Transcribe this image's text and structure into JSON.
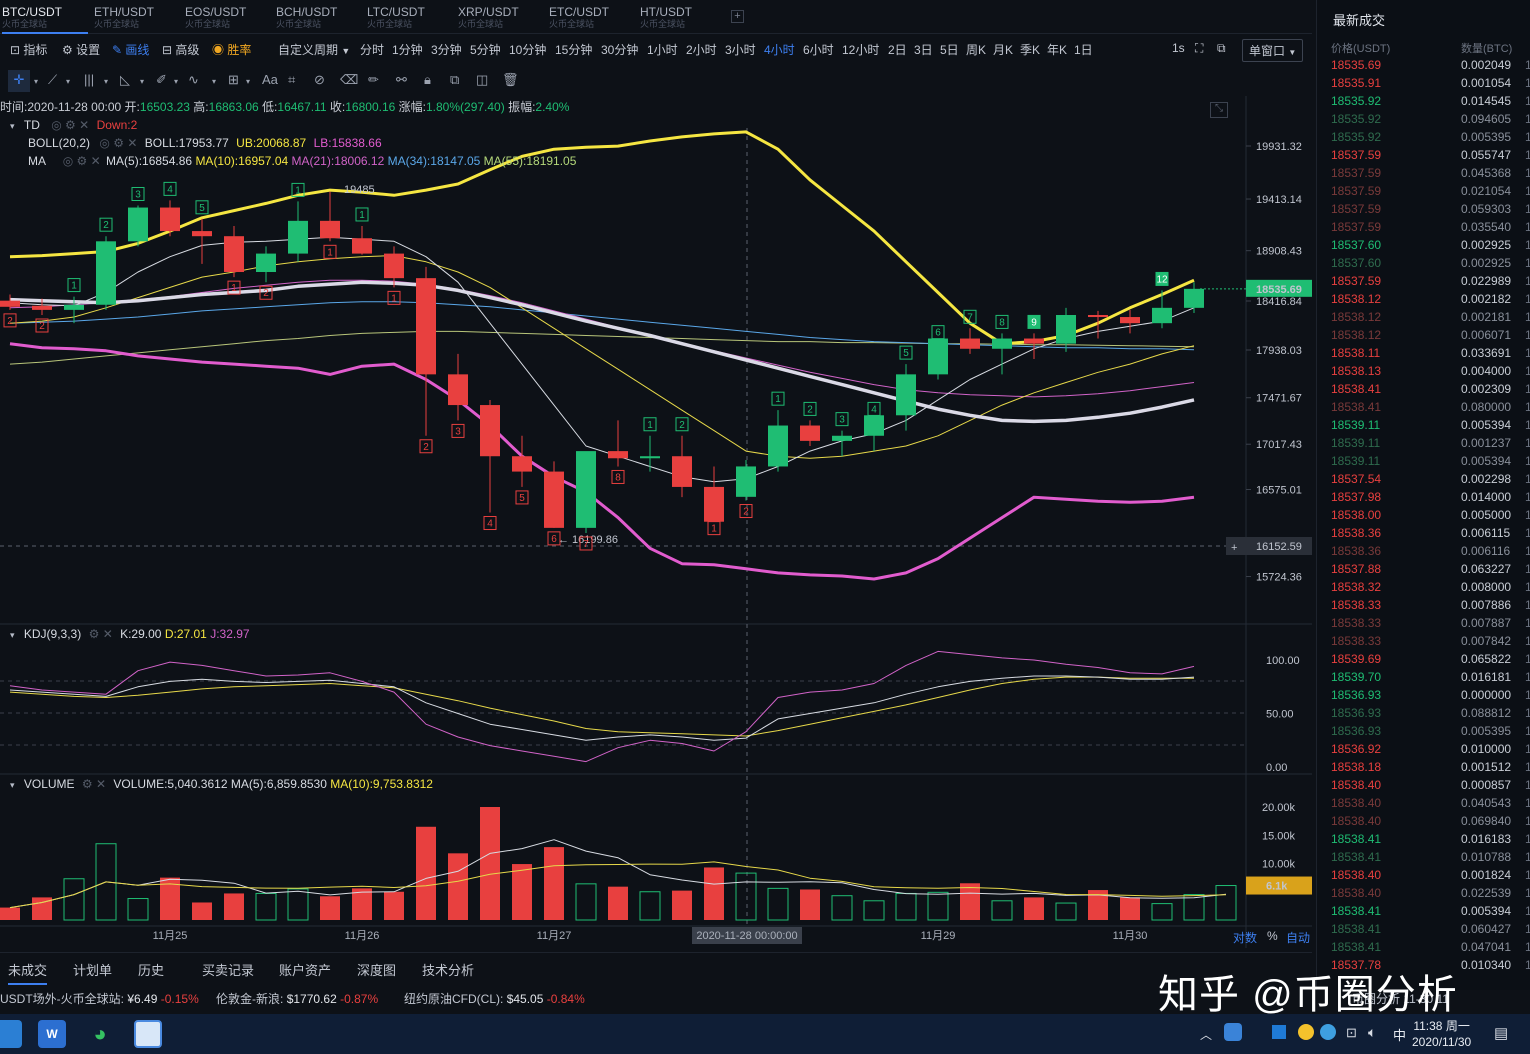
{
  "tabs": [
    {
      "label": "BTC/USDT",
      "sub": "火币全球站",
      "active": true
    },
    {
      "label": "ETH/USDT",
      "sub": "火币全球站"
    },
    {
      "label": "EOS/USDT",
      "sub": "火币全球站"
    },
    {
      "label": "BCH/USDT",
      "sub": "火币全球站"
    },
    {
      "label": "LTC/USDT",
      "sub": "火币全球站"
    },
    {
      "label": "XRP/USDT",
      "sub": "火币全球站"
    },
    {
      "label": "ETC/USDT",
      "sub": "火币全球站"
    },
    {
      "label": "HT/USDT",
      "sub": "火币全球站"
    }
  ],
  "tab_add": "+",
  "toolbar": {
    "indicators": "指标",
    "settings": "设置",
    "draw": "画线",
    "advanced": "高级",
    "winrate": "胜率",
    "custom_period": "自定义周期",
    "periods": [
      "分时",
      "1分钟",
      "3分钟",
      "5分钟",
      "10分钟",
      "15分钟",
      "30分钟",
      "1小时",
      "2小时",
      "3小时",
      "4小时",
      "6小时",
      "12小时",
      "2日",
      "3日",
      "5日",
      "周K",
      "月K",
      "季K",
      "年K",
      "1日"
    ],
    "active_period": "4小时",
    "interval_1s": "1s",
    "window_select": "单窗口"
  },
  "drawing_tools_text": "Aa",
  "info": {
    "time_label": "时间:",
    "time": "2020-11-28 00:00",
    "open_label": "开:",
    "open": "16503.23",
    "high_label": "高:",
    "high": "16863.06",
    "low_label": "低:",
    "low": "16467.11",
    "close_label": "收:",
    "close": "16800.16",
    "change_label": "涨幅:",
    "change": "1.80%(297.40)",
    "amp_label": "振幅:",
    "amp": "2.40%"
  },
  "td_legend": {
    "name": "TD",
    "status": "Down:2"
  },
  "boll_legend": {
    "name": "BOLL(20,2)",
    "boll": "BOLL:17953.77",
    "ub": "UB:20068.87",
    "lb": "LB:15838.66"
  },
  "ma_legend": {
    "name": "MA",
    "ma5": "MA(5):16854.86",
    "ma10": "MA(10):16957.04",
    "ma21": "MA(21):18006.12",
    "ma34": "MA(34):18147.05",
    "ma55": "MA(55):18191.05"
  },
  "kdj_legend": {
    "name": "KDJ(9,3,3)",
    "k": "K:29.00",
    "d": "D:27.01",
    "j": "J:32.97"
  },
  "vol_legend": {
    "name": "VOLUME",
    "vol": "VOLUME:5,040.3612",
    "ma5": "MA(5):6,859.8530",
    "ma10": "MA(10):9,753.8312"
  },
  "price_axis": [
    "19931.32",
    "19413.14",
    "18908.43",
    "18416.84",
    "17938.03",
    "17471.67",
    "17017.43",
    "16575.01",
    "15724.36"
  ],
  "last_price": "18535.69",
  "crosshair_price": "16152.59",
  "high_marker": "19485",
  "low_marker": "← 16199.86",
  "kdj_axis": [
    "100.00",
    "50.00",
    "0.00"
  ],
  "vol_axis": [
    "20.00k",
    "15.00k",
    "10.00k"
  ],
  "vol_current": "6.1k",
  "x_labels": [
    "11月25",
    "11月26",
    "11月27",
    "11月29",
    "11月30"
  ],
  "crosshair_time": "2020-11-28 00:00:00",
  "axis_modes": [
    "对数",
    "%",
    "自动"
  ],
  "colors": {
    "up": "#1fbd73",
    "down": "#e8403f",
    "boll_ub": "#f5e642",
    "boll_lb": "#e15cce",
    "ma_white": "#e6e6ea"
  },
  "chart_data": {
    "type": "candlestick",
    "interval": "4小时",
    "candles": [
      {
        "o": 18420,
        "h": 18480,
        "l": 18330,
        "c": 18360,
        "td": "2",
        "tdc": "down"
      },
      {
        "o": 18370,
        "h": 18440,
        "l": 18280,
        "c": 18330,
        "td": "2",
        "tdc": "down"
      },
      {
        "o": 18330,
        "h": 18460,
        "l": 18200,
        "c": 18380,
        "td": "1",
        "tdc": "up"
      },
      {
        "o": 18380,
        "h": 19050,
        "l": 18330,
        "c": 19000,
        "td": "2",
        "tdc": "up"
      },
      {
        "o": 19000,
        "h": 19350,
        "l": 18950,
        "c": 19330,
        "td": "3",
        "tdc": "up"
      },
      {
        "o": 19330,
        "h": 19400,
        "l": 19050,
        "c": 19100,
        "td": "4",
        "tdc": "up"
      },
      {
        "o": 19100,
        "h": 19220,
        "l": 18780,
        "c": 19050,
        "td": "5",
        "tdc": "up"
      },
      {
        "o": 19050,
        "h": 19150,
        "l": 18650,
        "c": 18700,
        "td": "1",
        "tdc": "down"
      },
      {
        "o": 18700,
        "h": 18950,
        "l": 18600,
        "c": 18880,
        "td": "2",
        "tdc": "down"
      },
      {
        "o": 18880,
        "h": 19390,
        "l": 18800,
        "c": 19200,
        "td": "1",
        "tdc": "up"
      },
      {
        "o": 19200,
        "h": 19485,
        "l": 19000,
        "c": 19030,
        "td": "1",
        "tdc": "down"
      },
      {
        "o": 19030,
        "h": 19150,
        "l": 18870,
        "c": 18880,
        "td": "1",
        "tdc": "up"
      },
      {
        "o": 18880,
        "h": 18950,
        "l": 18550,
        "c": 18640,
        "td": "1",
        "tdc": "down"
      },
      {
        "o": 18640,
        "h": 18750,
        "l": 17100,
        "c": 17700,
        "td": "2",
        "tdc": "down"
      },
      {
        "o": 17700,
        "h": 17900,
        "l": 17250,
        "c": 17400,
        "td": "3",
        "tdc": "down"
      },
      {
        "o": 17400,
        "h": 17450,
        "l": 16350,
        "c": 16900,
        "td": "4",
        "tdc": "down"
      },
      {
        "o": 16900,
        "h": 17100,
        "l": 16600,
        "c": 16750,
        "td": "5",
        "tdc": "down"
      },
      {
        "o": 16750,
        "h": 16850,
        "l": 16199.86,
        "c": 16200,
        "td": "6",
        "tdc": "down"
      },
      {
        "o": 16200,
        "h": 16900,
        "l": 16150,
        "c": 16950,
        "td": "7",
        "tdc": "down"
      },
      {
        "o": 16950,
        "h": 17250,
        "l": 16800,
        "c": 16880,
        "td": "8",
        "tdc": "down"
      },
      {
        "o": 16880,
        "h": 17100,
        "l": 16750,
        "c": 16900,
        "td": "1",
        "tdc": "up"
      },
      {
        "o": 16900,
        "h": 17100,
        "l": 16500,
        "c": 16600,
        "td": "2",
        "tdc": "up"
      },
      {
        "o": 16600,
        "h": 16800,
        "l": 16300,
        "c": 16260,
        "td": "1",
        "tdc": "down"
      },
      {
        "o": 16503.23,
        "h": 16863.06,
        "l": 16467.11,
        "c": 16800.16,
        "td": "2",
        "tdc": "down"
      },
      {
        "o": 16800,
        "h": 17350,
        "l": 16750,
        "c": 17200,
        "td": "1",
        "tdc": "up"
      },
      {
        "o": 17200,
        "h": 17250,
        "l": 17000,
        "c": 17050,
        "td": "2",
        "tdc": "up"
      },
      {
        "o": 17050,
        "h": 17150,
        "l": 16900,
        "c": 17100,
        "td": "3",
        "tdc": "up"
      },
      {
        "o": 17100,
        "h": 17250,
        "l": 16950,
        "c": 17300,
        "td": "4",
        "tdc": "up"
      },
      {
        "o": 17300,
        "h": 17800,
        "l": 17150,
        "c": 17700,
        "td": "5",
        "tdc": "up"
      },
      {
        "o": 17700,
        "h": 18000,
        "l": 17650,
        "c": 18050,
        "td": "6",
        "tdc": "up"
      },
      {
        "o": 18050,
        "h": 18150,
        "l": 17900,
        "c": 17950,
        "td": "7",
        "tdc": "up"
      },
      {
        "o": 17950,
        "h": 18100,
        "l": 17700,
        "c": 18050,
        "td": "8",
        "tdc": "up"
      },
      {
        "o": 18050,
        "h": 18100,
        "l": 17850,
        "c": 18000,
        "td": "9",
        "tdc": "up9"
      },
      {
        "o": 18000,
        "h": 18350,
        "l": 17920,
        "c": 18280,
        "td": "",
        "tdc": "up"
      },
      {
        "o": 18280,
        "h": 18320,
        "l": 18050,
        "c": 18260,
        "td": "",
        "tdc": "up"
      },
      {
        "o": 18260,
        "h": 18330,
        "l": 18100,
        "c": 18200,
        "td": "",
        "tdc": "down"
      },
      {
        "o": 18200,
        "h": 18520,
        "l": 18150,
        "c": 18350,
        "td": "12",
        "tdc": "up"
      },
      {
        "o": 18350,
        "h": 18600,
        "l": 18300,
        "c": 18535.69,
        "td": "",
        "tdc": "up"
      }
    ],
    "volume": [
      2200,
      4000,
      7300,
      13500,
      3800,
      7500,
      3100,
      4700,
      4700,
      5500,
      4200,
      5600,
      5000,
      16500,
      11800,
      20000,
      9900,
      12900,
      6400,
      5900,
      5000,
      5200,
      9300,
      8300,
      5600,
      5400,
      4300,
      3400,
      4700,
      4900,
      6500,
      3400,
      4000,
      3000,
      5300,
      4000,
      2900,
      4500,
      6100
    ],
    "boll": {
      "ub": [
        18850,
        18860,
        18880,
        18900,
        18980,
        19100,
        19230,
        19300,
        19370,
        19450,
        19500,
        19480,
        19450,
        19500,
        19560,
        19700,
        19830,
        19900,
        19920,
        19930,
        19980,
        20020,
        20050,
        20068.87,
        19900,
        19600,
        19350,
        19100,
        18800,
        18500,
        18200,
        18000,
        18020,
        18080,
        18200,
        18350,
        18480,
        18620
      ],
      "lb": [
        18000,
        17960,
        17950,
        17930,
        17880,
        17850,
        17820,
        17800,
        17780,
        17760,
        17700,
        17780,
        17800,
        17650,
        17450,
        17200,
        16900,
        16700,
        16550,
        16300,
        16000,
        15850,
        15838.66,
        15800,
        15760,
        15740,
        15730,
        15700,
        15760,
        15900,
        16100,
        16300,
        16500,
        16480,
        16460,
        16450,
        16460,
        16500
      ]
    },
    "kdj": {
      "k": [
        72,
        70,
        68,
        66,
        75,
        80,
        82,
        80,
        79,
        80,
        81,
        78,
        75,
        60,
        50,
        40,
        35,
        30,
        25,
        28,
        30,
        28,
        25,
        27,
        45,
        50,
        55,
        60,
        68,
        75,
        80,
        83,
        85,
        85,
        84,
        82,
        82,
        84
      ],
      "d": [
        70,
        68,
        66,
        65,
        67,
        70,
        73,
        75,
        76,
        77,
        78,
        76,
        74,
        68,
        62,
        55,
        49,
        43,
        36,
        33,
        32,
        31,
        30,
        29,
        34,
        40,
        46,
        52,
        58,
        65,
        72,
        78,
        82,
        84,
        84,
        83,
        83,
        83
      ],
      "j": [
        76,
        72,
        70,
        68,
        90,
        98,
        95,
        90,
        85,
        86,
        88,
        80,
        70,
        40,
        28,
        20,
        15,
        10,
        5,
        18,
        25,
        22,
        15,
        33,
        65,
        70,
        72,
        78,
        95,
        108,
        105,
        102,
        100,
        96,
        93,
        88,
        87,
        94
      ]
    },
    "ma_white": [
      18430,
      18420,
      18410,
      18400,
      18420,
      18450,
      18480,
      18500,
      18520,
      18560,
      18580,
      18600,
      18590,
      18570,
      18520,
      18450,
      18380,
      18300,
      18220,
      18150,
      18080,
      18000,
      17920,
      17840,
      17760,
      17680,
      17600,
      17520,
      17440,
      17360,
      17300,
      17250,
      17240,
      17250,
      17280,
      17320,
      17380,
      17450
    ],
    "ma5": [
      18400,
      18380,
      18370,
      18500,
      18700,
      18850,
      18960,
      18990,
      19000,
      19020,
      19040,
      19020,
      19000,
      18850,
      18600,
      18200,
      17800,
      17400,
      17000,
      16900,
      16800,
      16700,
      16650,
      16680,
      16800,
      16950,
      17050,
      17120,
      17250,
      17450,
      17650,
      17800,
      17950,
      18050,
      18120,
      18170,
      18220,
      18350
    ],
    "ma10": [
      18200,
      18220,
      18260,
      18350,
      18450,
      18550,
      18650,
      18700,
      18760,
      18800,
      18830,
      18850,
      18860,
      18800,
      18700,
      18550,
      18350,
      18150,
      17950,
      17750,
      17550,
      17350,
      17150,
      16950,
      16900,
      16880,
      16900,
      16950,
      17000,
      17100,
      17250,
      17400,
      17520,
      17620,
      17720,
      17800,
      17900,
      17980
    ],
    "ma21": [
      18350,
      18360,
      18380,
      18400,
      18430,
      18460,
      18500,
      18540,
      18570,
      18600,
      18620,
      18620,
      18610,
      18580,
      18530,
      18470,
      18400,
      18320,
      18240,
      18160,
      18080,
      18000,
      17930,
      17860,
      17790,
      17720,
      17660,
      17600,
      17550,
      17520,
      17500,
      17490,
      17480,
      17490,
      17510,
      17540,
      17580,
      17620
    ],
    "ma34": [
      18200,
      18210,
      18220,
      18240,
      18260,
      18290,
      18320,
      18340,
      18360,
      18380,
      18400,
      18410,
      18410,
      18400,
      18380,
      18360,
      18330,
      18300,
      18270,
      18240,
      18210,
      18180,
      18150,
      18120,
      18090,
      18060,
      18040,
      18020,
      18010,
      18000,
      17990,
      17980,
      17970,
      17960,
      17960,
      17950,
      17950,
      17940
    ],
    "ma55": [
      17800,
      17820,
      17850,
      17880,
      17910,
      17940,
      17970,
      18000,
      18030,
      18050,
      18080,
      18100,
      18110,
      18120,
      18120,
      18110,
      18100,
      18090,
      18080,
      18070,
      18060,
      18050,
      18040,
      18030,
      18020,
      18020,
      18010,
      18010,
      18005,
      18000,
      18000,
      17995,
      17990,
      17990,
      17985,
      17980,
      17975,
      17970
    ]
  },
  "right_panel": {
    "title": "最新成交",
    "col_price": "价格(USDT)",
    "col_amount": "数量(BTC)",
    "trades": [
      {
        "p": "18535.69",
        "q": "0.002049",
        "s": "sell"
      },
      {
        "p": "18535.91",
        "q": "0.001054",
        "s": "sell"
      },
      {
        "p": "18535.92",
        "q": "0.014545",
        "s": "buy"
      },
      {
        "p": "18535.92",
        "q": "0.094605",
        "s": "buy_dim"
      },
      {
        "p": "18535.92",
        "q": "0.005395",
        "s": "buy_dim"
      },
      {
        "p": "18537.59",
        "q": "0.055747",
        "s": "sell"
      },
      {
        "p": "18537.59",
        "q": "0.045368",
        "s": "sell_dim"
      },
      {
        "p": "18537.59",
        "q": "0.021054",
        "s": "sell_dim"
      },
      {
        "p": "18537.59",
        "q": "0.059303",
        "s": "sell_dim"
      },
      {
        "p": "18537.59",
        "q": "0.035540",
        "s": "sell_dim"
      },
      {
        "p": "18537.60",
        "q": "0.002925",
        "s": "buy"
      },
      {
        "p": "18537.60",
        "q": "0.002925",
        "s": "buy_dim"
      },
      {
        "p": "18537.59",
        "q": "0.022989",
        "s": "sell"
      },
      {
        "p": "18538.12",
        "q": "0.002182",
        "s": "sell"
      },
      {
        "p": "18538.12",
        "q": "0.002181",
        "s": "sell_dim"
      },
      {
        "p": "18538.12",
        "q": "0.006071",
        "s": "sell_dim"
      },
      {
        "p": "18538.11",
        "q": "0.033691",
        "s": "sell"
      },
      {
        "p": "18538.13",
        "q": "0.004000",
        "s": "sell"
      },
      {
        "p": "18538.41",
        "q": "0.002309",
        "s": "sell"
      },
      {
        "p": "18538.41",
        "q": "0.080000",
        "s": "sell_dim"
      },
      {
        "p": "18539.11",
        "q": "0.005394",
        "s": "buy"
      },
      {
        "p": "18539.11",
        "q": "0.001237",
        "s": "buy_dim"
      },
      {
        "p": "18539.11",
        "q": "0.005394",
        "s": "buy_dim"
      },
      {
        "p": "18537.54",
        "q": "0.002298",
        "s": "sell"
      },
      {
        "p": "18537.98",
        "q": "0.014000",
        "s": "sell"
      },
      {
        "p": "18538.00",
        "q": "0.005000",
        "s": "sell"
      },
      {
        "p": "18538.36",
        "q": "0.006115",
        "s": "sell"
      },
      {
        "p": "18538.36",
        "q": "0.006116",
        "s": "sell_dim"
      },
      {
        "p": "18537.88",
        "q": "0.063227",
        "s": "sell"
      },
      {
        "p": "18538.32",
        "q": "0.008000",
        "s": "sell"
      },
      {
        "p": "18538.33",
        "q": "0.007886",
        "s": "sell"
      },
      {
        "p": "18538.33",
        "q": "0.007887",
        "s": "sell_dim"
      },
      {
        "p": "18538.33",
        "q": "0.007842",
        "s": "sell_dim"
      },
      {
        "p": "18539.69",
        "q": "0.065822",
        "s": "sell"
      },
      {
        "p": "18539.70",
        "q": "0.016181",
        "s": "buy"
      },
      {
        "p": "18536.93",
        "q": "0.000000",
        "s": "buy"
      },
      {
        "p": "18536.93",
        "q": "0.088812",
        "s": "buy_dim"
      },
      {
        "p": "18536.93",
        "q": "0.005395",
        "s": "buy_dim"
      },
      {
        "p": "18536.92",
        "q": "0.010000",
        "s": "sell"
      },
      {
        "p": "18538.18",
        "q": "0.001512",
        "s": "sell"
      },
      {
        "p": "18538.40",
        "q": "0.000857",
        "s": "sell"
      },
      {
        "p": "18538.40",
        "q": "0.040543",
        "s": "sell_dim"
      },
      {
        "p": "18538.40",
        "q": "0.069840",
        "s": "sell_dim"
      },
      {
        "p": "18538.41",
        "q": "0.016183",
        "s": "buy"
      },
      {
        "p": "18538.41",
        "q": "0.010788",
        "s": "buy_dim"
      },
      {
        "p": "18538.40",
        "q": "0.001824",
        "s": "sell"
      },
      {
        "p": "18538.40",
        "q": "0.022539",
        "s": "sell_dim"
      },
      {
        "p": "18538.41",
        "q": "0.005394",
        "s": "buy"
      },
      {
        "p": "18538.41",
        "q": "0.060427",
        "s": "buy_dim"
      },
      {
        "p": "18538.41",
        "q": "0.047041",
        "s": "buy_dim"
      },
      {
        "p": "18537.78",
        "q": "0.010340",
        "s": "sell"
      }
    ]
  },
  "bottom_tabs": [
    "未成交",
    "计划单",
    "历史",
    "买卖记录",
    "账户资产",
    "深度图",
    "技术分析"
  ],
  "ticker": [
    {
      "name": "USDT场外-火币全球站:",
      "price": "¥6.49",
      "chg": "-0.15%"
    },
    {
      "name": "伦敦金-新浪:",
      "price": "$1770.62",
      "chg": "-0.87%"
    },
    {
      "name": "纽约原油CFD(CL):",
      "price": "$45.05",
      "chg": "-0.84%"
    }
  ],
  "ticker_right": "币圈分析 11-30 11",
  "watermark": "知乎 @币圈分析",
  "taskbar": {
    "time": "11:38 周一",
    "date": "2020/11/30",
    "ime": "中"
  }
}
